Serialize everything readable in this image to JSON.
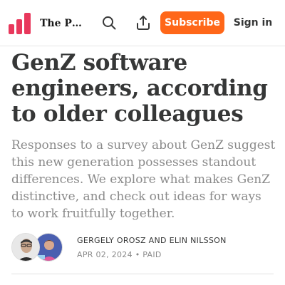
{
  "header": {
    "publication_name": "The Pr…",
    "search_icon": "search-icon",
    "share_icon": "share-icon",
    "subscribe_label": "Subscribe",
    "signin_label": "Sign in"
  },
  "colors": {
    "accent": "#ff6719",
    "logo": "#e8385c",
    "text": "#363737",
    "muted": "#8a8a8a"
  },
  "article": {
    "title": "GenZ software engineers, according to older colleagues",
    "subtitle": "Responses to a survey about GenZ suggest this new generation possesses standout differences. We explore what makes GenZ distinctive, and check out ideas for ways to work fruitfully together.",
    "authors": "GERGELY OROSZ AND ELIN NILSSON",
    "date": "APR 02, 2024",
    "separator": "•",
    "access": "PAID"
  }
}
